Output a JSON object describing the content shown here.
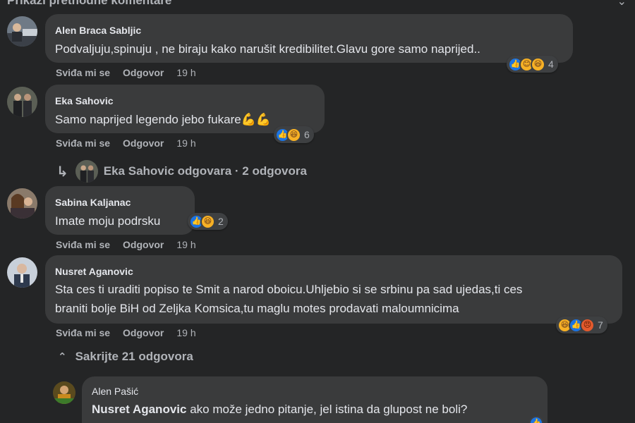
{
  "header": {
    "partial_title": "Prikaži prethodne komentare"
  },
  "actions": {
    "like": "Sviđa mi se",
    "reply": "Odgovor"
  },
  "colors": {
    "background": "#242526",
    "bubble": "#3a3b3c",
    "like": "#1b74e4",
    "haha": "#f7b125",
    "angry": "#e45a2d"
  },
  "comments": [
    {
      "author": "Alen Braca Sabljic",
      "text": "Podvaljuju,spinuju , ne biraju kako narušit kredibilitet.Glavu gore samo naprijed..",
      "time": "19 h",
      "reactions": [
        "like",
        "care",
        "haha"
      ],
      "reaction_count": "4"
    },
    {
      "author": "Eka Sahovic",
      "text": "Samo naprijed legendo jebo fukare",
      "emoji": "💪💪",
      "time": "19 h",
      "reactions": [
        "like",
        "haha"
      ],
      "reaction_count": "6",
      "replies_text": "Eka Sahovic odgovara · 2 odgovora"
    },
    {
      "author": "Sabina Kaljanac",
      "text": "Imate moju podrsku",
      "time": "19 h",
      "reactions": [
        "like",
        "haha"
      ],
      "reaction_count": "2"
    },
    {
      "author": "Nusret Aganovic",
      "text_line1": "Sta ces ti uraditi popiso te Smit a narod oboicu.Uhljebio si se srbinu pa sad ujedas,ti ces",
      "text_line2": "braniti bolje BiH od Zeljka Komsica,tu maglu motes prodavati maloumnicima",
      "time": "19 h",
      "reactions": [
        "haha",
        "like",
        "angry"
      ],
      "reaction_count": "7",
      "hide_replies_text": "Sakrijte 21 odgovora"
    }
  ],
  "reply": {
    "author": "Alen Pašić",
    "mention": "Nusret Aganovic",
    "text": " ako može jedno pitanje, jel istina da glupost ne boli?"
  }
}
